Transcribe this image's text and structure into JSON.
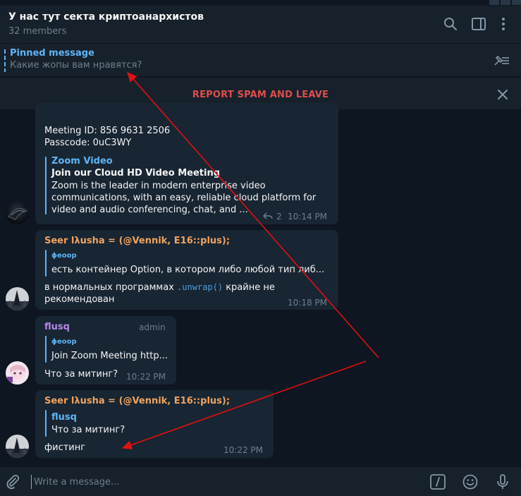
{
  "colors": {
    "accent": "#5eb5f7",
    "danger": "#e04d4d",
    "muted": "#6d7f8f",
    "bubble": "#182533",
    "background": "#0e1621",
    "panel": "#17212b",
    "annotation_arrow": "#e01010"
  },
  "header": {
    "title": "У нас тут секта криптоанархистов",
    "members": "32 members",
    "icons": [
      "search-icon",
      "sidebar-toggle-icon",
      "more-vertical-icon"
    ]
  },
  "pinned": {
    "title": "Pinned message",
    "text": "Какие жопы вам нравятся?",
    "icon": "pin-list-icon"
  },
  "report": {
    "label": "REPORT SPAM AND LEAVE",
    "close_icon": "close-icon"
  },
  "messages": [
    {
      "meeting_id": "Meeting ID: 856 9631 2506",
      "passcode": "Passcode: 0uC3WY",
      "preview_site": "Zoom Video",
      "preview_title": "Join our Cloud HD Video Meeting",
      "preview_desc_1": "Zoom is the leader in modern enterprise video",
      "preview_desc_2": "communications, with an easy, reliable cloud platform for",
      "preview_desc_3": "video and audio conferencing, chat, and ...",
      "replies": "2",
      "time": "10:14 PM"
    },
    {
      "author": "Seer lλusha = (@Vennik, E16::plus);",
      "reply_author": "ϕеоор",
      "reply_text": "есть контейнер Option, в котором либо любой тип либ...",
      "text_before": "в нормальных программах",
      "code": ".unwrap()",
      "text_after": "крайне не",
      "text_line2": "рекомендован",
      "time": "10:18 PM"
    },
    {
      "author": "flusq",
      "role": "admin",
      "reply_author": "ϕеоор",
      "reply_text": "Join Zoom Meeting http...",
      "text": "Что за митинг?",
      "time": "10:22 PM"
    },
    {
      "author": "Seer lλusha = (@Vennik, E16::plus);",
      "reply_author": "flusq",
      "reply_text": "Что за митинг?",
      "text": "фистинг",
      "time": "10:22 PM"
    }
  ],
  "composer": {
    "placeholder": "Write a message...",
    "icons": [
      "attach-icon",
      "commands-icon",
      "emoji-icon",
      "microphone-icon"
    ]
  }
}
